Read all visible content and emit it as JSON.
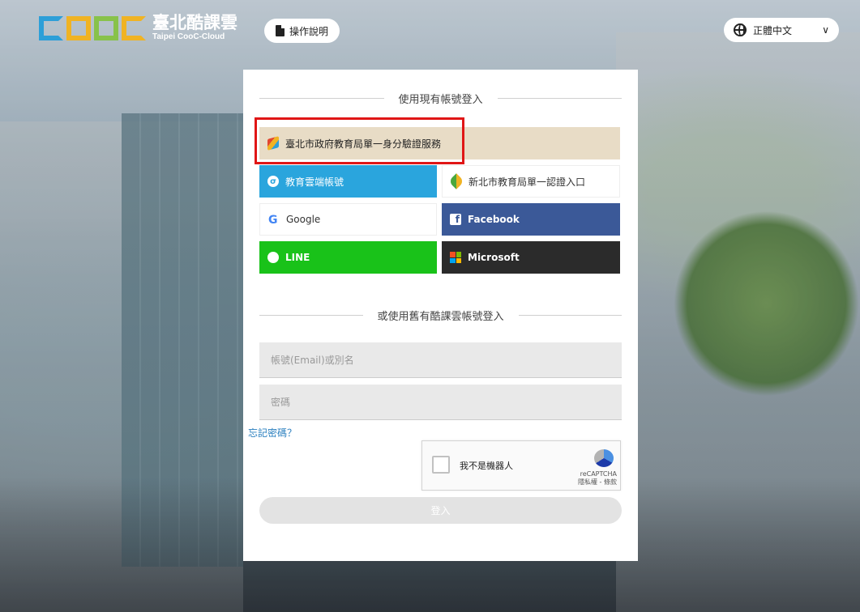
{
  "header": {
    "logo_cn": "臺北酷課雲",
    "logo_en": "Taipei CooC-Cloud",
    "help_label": "操作說明",
    "language_label": "正體中文"
  },
  "login": {
    "section_title": "使用現有帳號登入",
    "taipei_sso_label": "臺北市政府教育局單一身分驗證服務",
    "edu_cloud_label": "教育雲端帳號",
    "ntpc_label": "新北市教育局單一認證入口",
    "google_label": "Google",
    "facebook_label": "Facebook",
    "line_label": "LINE",
    "microsoft_label": "Microsoft",
    "legacy_title": "或使用舊有酷課雲帳號登入",
    "account_placeholder": "帳號(Email)或別名",
    "password_placeholder": "密碼",
    "forgot_label": "忘記密碼？",
    "recaptcha_label": "我不是機器人",
    "recaptcha_brand": "reCAPTCHA",
    "recaptcha_links": "隱私權 - 條款",
    "submit_label": "登入"
  },
  "colors": {
    "facebook": "#3b5998",
    "line": "#19c219",
    "edu_cloud": "#2aa5dd",
    "highlight": "#e01616"
  }
}
